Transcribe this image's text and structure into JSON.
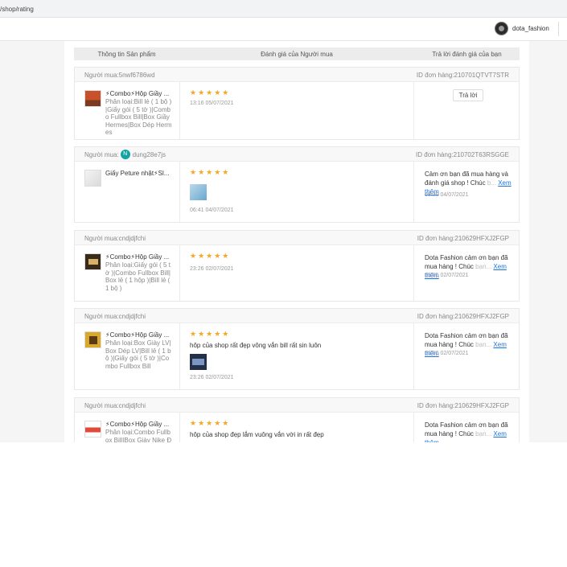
{
  "url": "/shop/rating",
  "header": {
    "username": "dota_fashion"
  },
  "table": {
    "col_product": "Thông tin Sản phẩm",
    "col_rating": "Đánh giá của Người mua",
    "col_reply": "Trả lời đánh giá của bạn"
  },
  "labels": {
    "reply_button": "Trả lời",
    "see_more": "Xem thêm"
  },
  "stars": "★★★★★",
  "reviews": [
    {
      "buyer": "Người mua:5nwf6786wd",
      "order_id": "ID đơn hàng:210701QTVT7STR",
      "product_name": "⚡Combo⚡Hộp Giầy ...",
      "variation": "Phân loại:Bill lẻ ( 1 bộ )|Giấy gói ( 5 tờ )|Combo Fullbox Bill|Box Giầy Hermes|Box Dép Hermes",
      "rating": 5,
      "comment": "",
      "time": "13:16 05/07/2021"
    },
    {
      "buyer": "Người mua:",
      "buyer_initial": "N",
      "buyer_name": "dung28e7js",
      "order_id": "ID đơn hàng:210702T63RSGGE",
      "product_name": "Giấy Peture nhật⚡Sl...",
      "variation": "",
      "rating": 5,
      "comment": "",
      "time": "06:41 04/07/2021",
      "reply_main": "Cảm ơn bạn đã mua hàng và đánh giá shop ! Chúc",
      "reply_faded": "b...",
      "reply_time": "08:20 04/07/2021"
    },
    {
      "buyer": "Người mua:cndjdjfchi",
      "order_id": "ID đơn hàng:210629HFXJ2FGP",
      "product_name": "⚡Combo⚡Hộp Giầy ...",
      "variation": "Phân loại:Giấy gói ( 5 tờ )|Combo Fullbox Bill|Box lẻ ( 1 hộp )|Bill lẻ ( 1 bộ )",
      "rating": 5,
      "comment": "",
      "time": "23:26 02/07/2021",
      "reply_main": "Dota Fashion cảm ơn bạn đã mua hàng ! Chúc",
      "reply_faded": "bạn...",
      "reply_time": "23:55 02/07/2021"
    },
    {
      "buyer": "Người mua:cndjdjfchi",
      "order_id": "ID đơn hàng:210629HFXJ2FGP",
      "product_name": "⚡Combo⚡Hộp Giầy ...",
      "variation": "Phân loại:Box Giày LV|Box Dép LV|Bill lẻ ( 1 bộ )|Giấy gói ( 5 tờ )|Combo Fullbox Bill",
      "rating": 5,
      "comment": "hôp của shop rất đẹp vông vắn bill rất sin luôn",
      "time": "23:26 02/07/2021",
      "reply_main": "Dota Fashion cảm ơn bạn đã mua hàng ! Chúc",
      "reply_faded": "bạn...",
      "reply_time": "23:56 02/07/2021"
    },
    {
      "buyer": "Người mua:cndjdjfchi",
      "order_id": "ID đơn hàng:210629HFXJ2FGP",
      "product_name": "⚡Combo⚡Hộp Giầy ...",
      "variation": "Phân loại:Combo Fullbox Bill|Box Giày Nike Đôi",
      "rating": 5,
      "comment": "hôp của shop đẹp lắm vuông vắn vời in rất đẹp",
      "time": "",
      "reply_main": "Dota Fashion cảm ơn bạn đã mua hàng ! Chúc",
      "reply_faded": "bạn...",
      "reply_time": ""
    }
  ]
}
